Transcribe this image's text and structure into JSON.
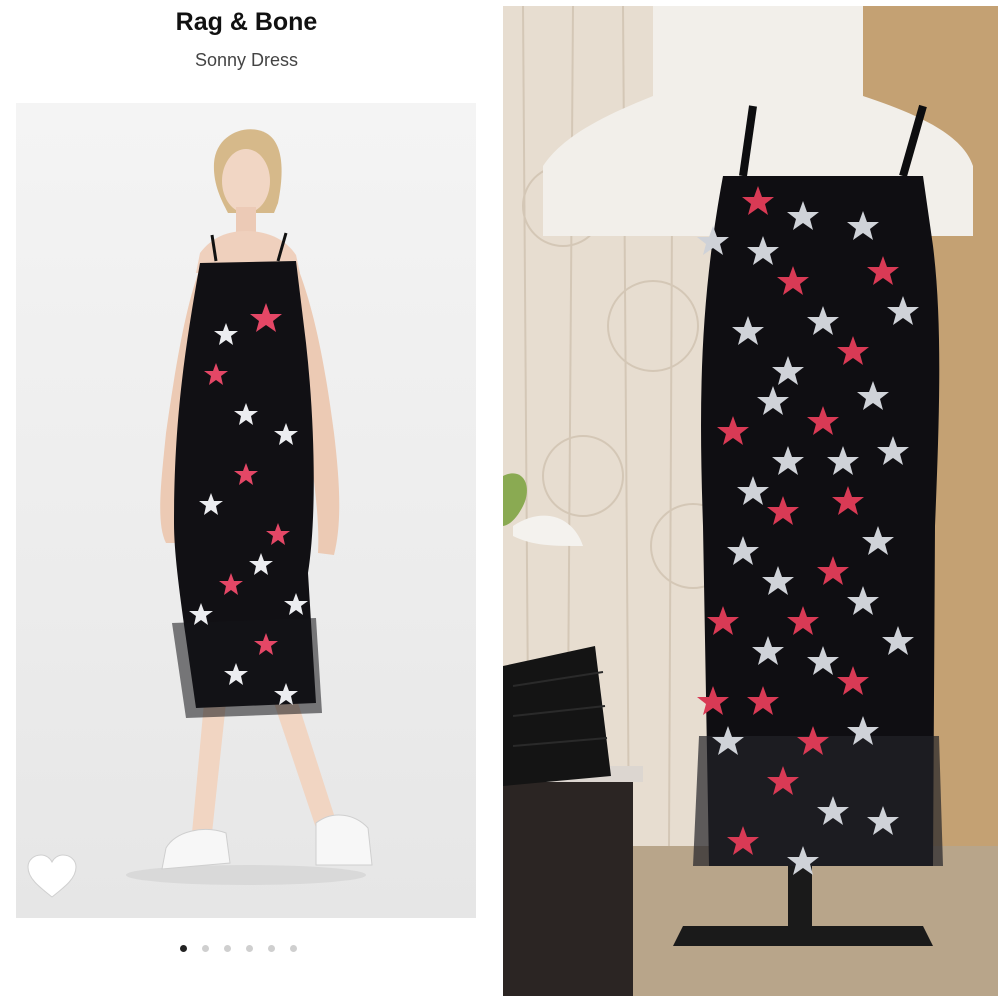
{
  "product": {
    "brand": "Rag & Bone",
    "name": "Sonny Dress"
  },
  "carousel": {
    "dot_count": 6,
    "active_index": 0
  },
  "icons": {
    "favorite": "heart-icon"
  },
  "colors": {
    "dress": "#111014",
    "star_red": "#d93a55",
    "star_white": "#d9dbe0",
    "wall": "#c8a77d"
  }
}
